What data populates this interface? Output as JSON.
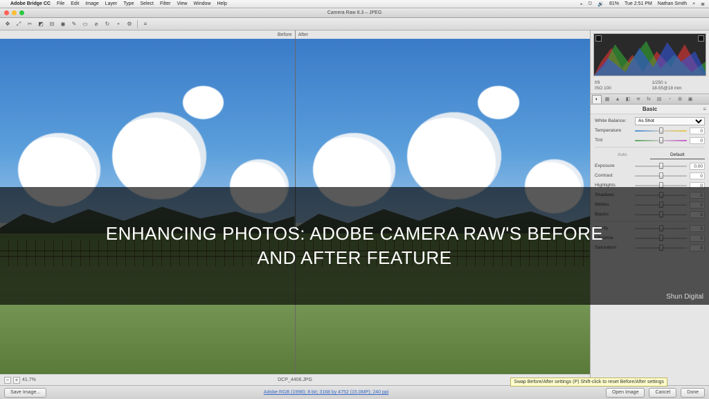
{
  "mac_menu": {
    "apple": "",
    "app": "Adobe Bridge CC",
    "items": [
      "File",
      "Edit",
      "Image",
      "Layer",
      "Type",
      "Select",
      "Filter",
      "View",
      "Window",
      "Help"
    ],
    "right": {
      "battery_pct": "81%",
      "time": "Tue 2:51 PM",
      "user": "Nathan Smith",
      "search_icon": "⌕",
      "wifi_icon": "⎋",
      "bt_icon": "⌁",
      "vol_icon": "🔊",
      "menu_icon": "≣"
    }
  },
  "window": {
    "title": "Camera Raw 8.3 – JPEG"
  },
  "toolbar_icons": [
    "✥",
    "⤢",
    "✂",
    "◩",
    "⊟",
    "◉",
    "✎",
    "▭",
    "⌀",
    "↻",
    "⚬",
    "⚙",
    "≡"
  ],
  "split": {
    "before": "Before",
    "after": "After"
  },
  "histogram": {
    "shadow_clip": false,
    "highlight_clip": false
  },
  "exif": {
    "f": "f/9",
    "shutter": "1/250 s",
    "iso": "ISO 100",
    "lens": "18-55@18 mm"
  },
  "panel_tabs": [
    "◐",
    "▦",
    "▲",
    "◧",
    "≋",
    "fx",
    "▤",
    "◔",
    "⊞",
    "▣"
  ],
  "basic": {
    "heading": "Basic",
    "wb_label": "White Balance:",
    "wb_value": "As Shot",
    "temp_label": "Temperature",
    "temp_val": "0",
    "tint_label": "Tint",
    "tint_val": "0",
    "subtabs": {
      "auto": "Auto",
      "default": "Default"
    },
    "exposure_label": "Exposure",
    "exposure_val": "0.00",
    "contrast_label": "Contrast",
    "contrast_val": "0",
    "highlights_label": "Highlights",
    "highlights_val": "0",
    "shadows_label": "Shadows",
    "shadows_val": "0",
    "whites_label": "Whites",
    "whites_val": "0",
    "blacks_label": "Blacks",
    "blacks_val": "0",
    "clarity_label": "Clarity",
    "clarity_val": "0",
    "vibrance_label": "Vibrance",
    "vibrance_val": "0",
    "saturation_label": "Saturation",
    "saturation_val": "0"
  },
  "preview_footer": {
    "zoom": "41.7%",
    "filename": "DCP_4406.JPG"
  },
  "footer": {
    "save": "Save Image...",
    "workflow": "Adobe RGB (1998); 8 bit; 3168 by 4752 (15.0MP); 240 ppi",
    "open": "Open Image",
    "cancel": "Cancel",
    "done": "Done"
  },
  "tooltip": "Swap Before/After settings (P)\nShift-click to reset Before/After settings",
  "overlay": {
    "line1": "ENHANCING PHOTOS: ADOBE CAMERA RAW'S BEFORE",
    "line2": "AND AFTER FEATURE",
    "watermark": "Shun Digital"
  }
}
